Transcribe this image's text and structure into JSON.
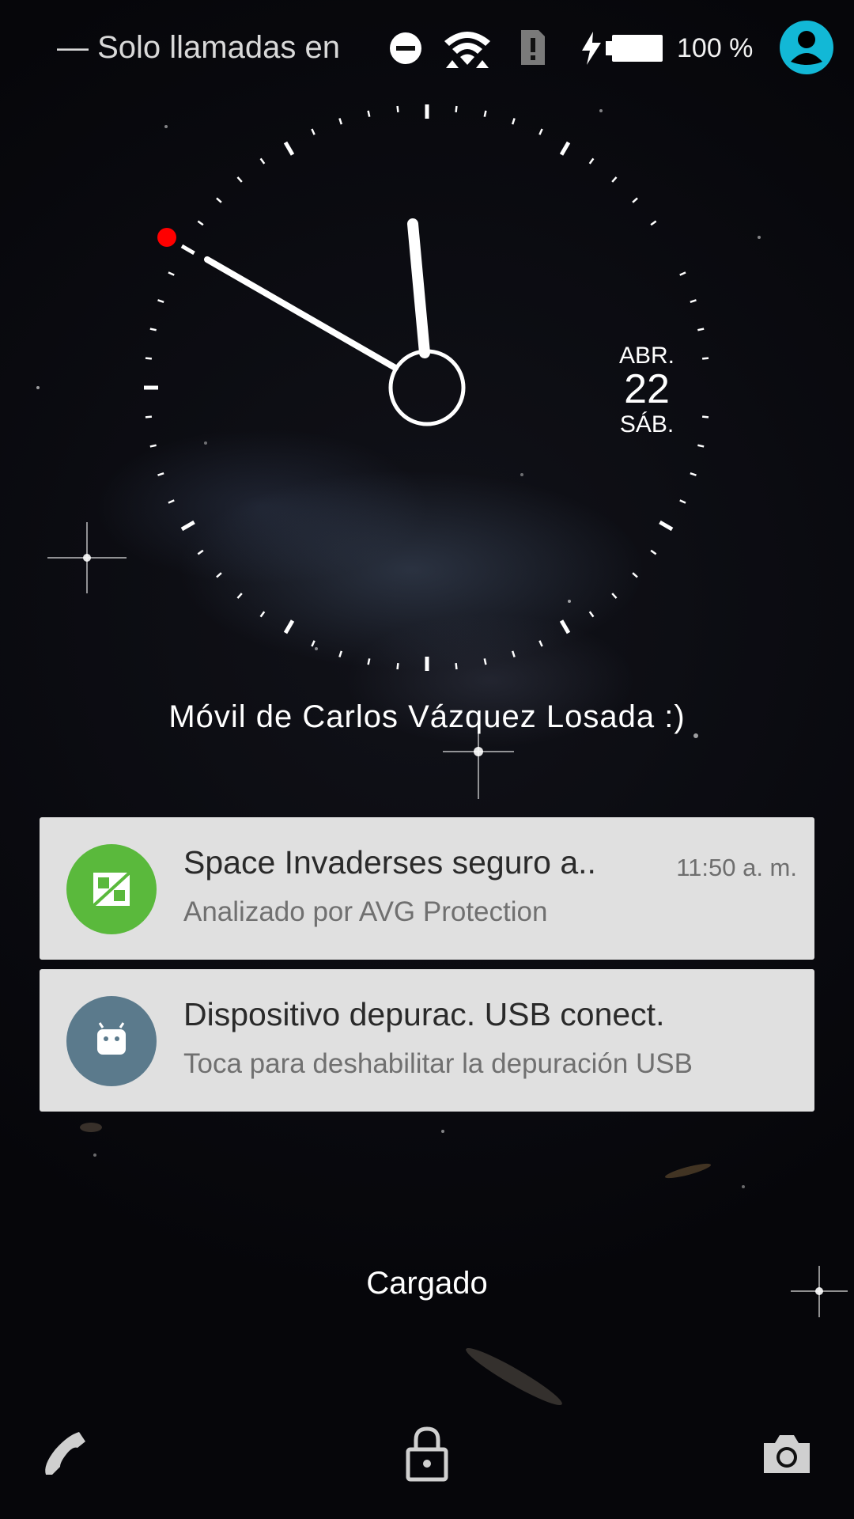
{
  "status_bar": {
    "dnd_text": "— Solo llamadas en",
    "battery_percent": "100 %"
  },
  "clock": {
    "date_month": "ABR.",
    "date_day": "22",
    "date_weekday": "SÁB."
  },
  "owner_info": "Móvil de Carlos Vázquez Losada :)",
  "notifications": [
    {
      "title": "Space Invaderses seguro a..",
      "text": "Analizado por AVG Protection",
      "time": "11:50 a. m.",
      "icon": "avg-shield-icon",
      "icon_color": "#5ab93c"
    },
    {
      "title": "Dispositivo depurac. USB conect.",
      "text": "Toca para deshabilitar la depuración USB",
      "time": "",
      "icon": "android-icon",
      "icon_color": "#5b7a8c"
    }
  ],
  "charging_status": "Cargado",
  "colors": {
    "avatar": "#12b8d6",
    "alarm_dot": "#ff0000",
    "notification_bg": "#e0e0e0"
  },
  "bottom_bar": {
    "left_icon": "phone-icon",
    "center_icon": "lock-icon",
    "right_icon": "camera-icon"
  }
}
